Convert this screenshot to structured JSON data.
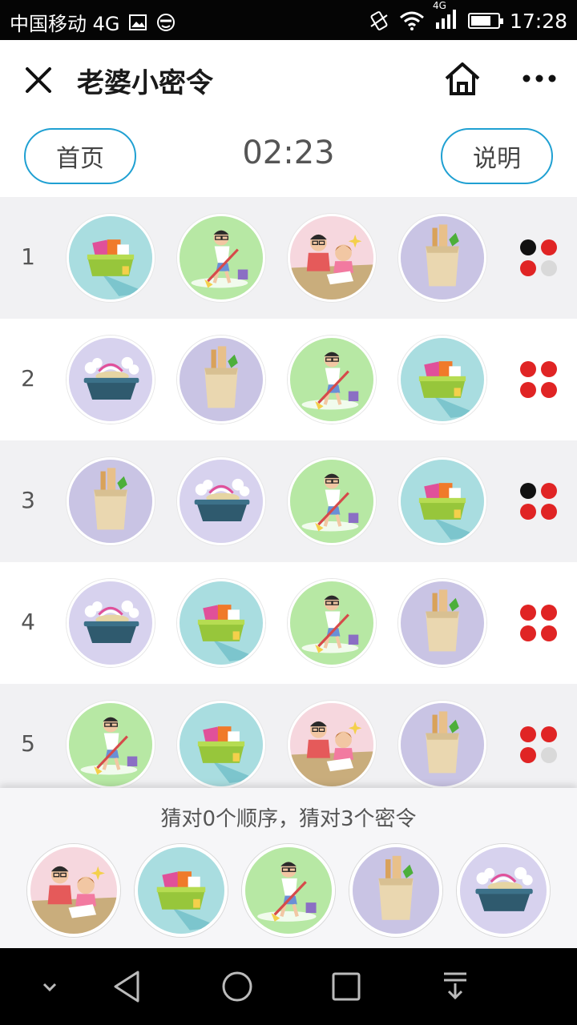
{
  "status_bar": {
    "carrier": "中国移动 4G",
    "time": "17:28",
    "network": "4G",
    "battery_level": 0.7,
    "icons": [
      "image-icon",
      "emoji-icon",
      "vibrate-icon",
      "wifi-icon",
      "signal-icon",
      "battery-icon"
    ]
  },
  "title_bar": {
    "title": "老婆小密令",
    "icons": [
      "close-icon",
      "home-icon",
      "more-icon"
    ]
  },
  "controls": {
    "home_label": "首页",
    "timer": "02:23",
    "help_label": "说明"
  },
  "rows": [
    {
      "num": "1",
      "tokens": [
        "laundry",
        "sweep",
        "study",
        "groceries"
      ],
      "pegs": [
        "black",
        "red",
        "red",
        "gray"
      ]
    },
    {
      "num": "2",
      "tokens": [
        "dishes",
        "groceries",
        "sweep",
        "laundry"
      ],
      "pegs": [
        "red",
        "red",
        "red",
        "red"
      ]
    },
    {
      "num": "3",
      "tokens": [
        "groceries",
        "dishes",
        "sweep",
        "laundry"
      ],
      "pegs": [
        "black",
        "red",
        "red",
        "red"
      ]
    },
    {
      "num": "4",
      "tokens": [
        "dishes",
        "laundry",
        "sweep",
        "groceries"
      ],
      "pegs": [
        "red",
        "red",
        "red",
        "red"
      ]
    },
    {
      "num": "5",
      "tokens": [
        "sweep",
        "laundry",
        "study",
        "groceries"
      ],
      "pegs": [
        "red",
        "red",
        "red",
        "gray"
      ]
    }
  ],
  "result": {
    "message": "猜对0个顺序，猜对3个密令"
  },
  "picker": [
    "study",
    "laundry",
    "sweep",
    "groceries",
    "dishes"
  ],
  "colors": {
    "accent": "#1fa0d2",
    "peg_red": "#e02424",
    "peg_black": "#111111",
    "peg_gray": "#d9d9d9",
    "row_shade": "#f1f1f3",
    "laundry_bg": "#a9dde0",
    "sweep_bg": "#b7e8a4",
    "study_bg": "#f6d7de",
    "groceries_bg": "#c9c4e4",
    "dishes_bg": "#d7d2ee"
  },
  "nav_bar": {
    "icons": [
      "chevron-down-icon",
      "back-icon",
      "home-circle-icon",
      "recents-icon",
      "notification-pull-icon"
    ]
  }
}
